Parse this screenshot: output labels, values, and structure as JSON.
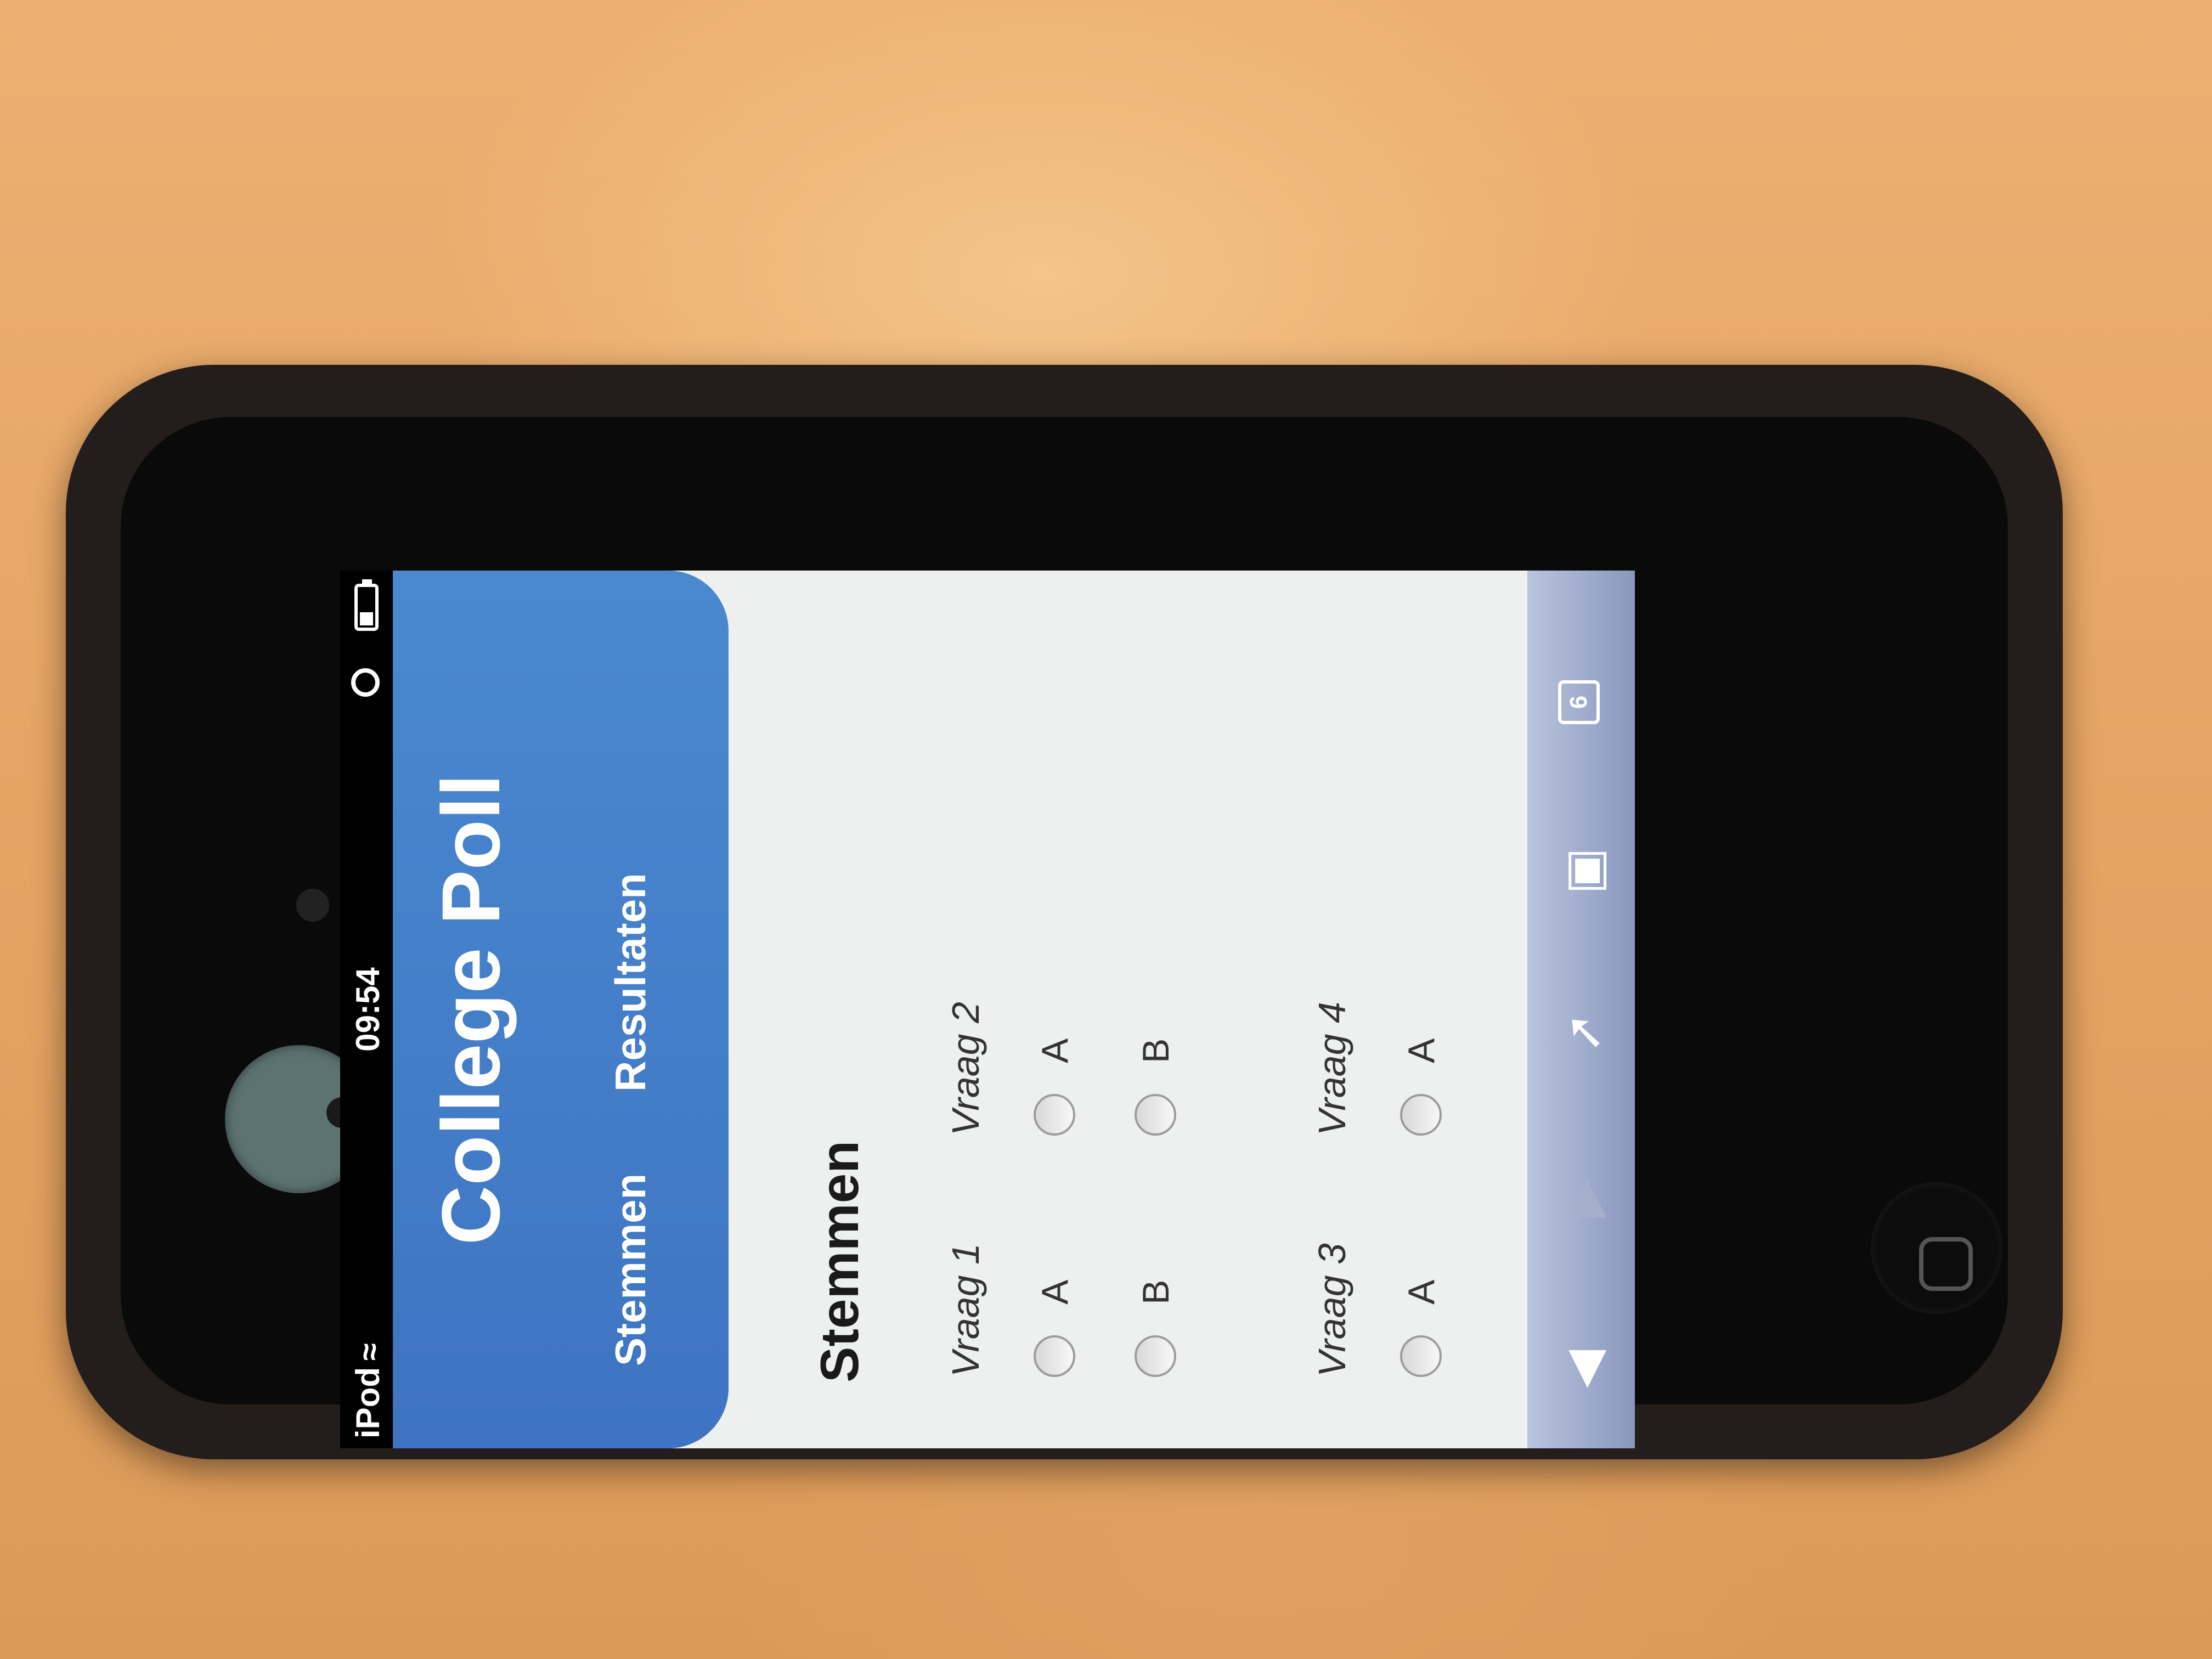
{
  "status_bar": {
    "carrier": "iPod",
    "time": "09:54"
  },
  "header": {
    "title": "College Poll",
    "tabs": [
      {
        "label": "Stemmen"
      },
      {
        "label": "Resultaten"
      }
    ]
  },
  "section_title": "Stemmen",
  "questions": [
    {
      "label": "Vraag 1",
      "options": [
        "A",
        "B"
      ]
    },
    {
      "label": "Vraag 2",
      "options": [
        "A",
        "B"
      ]
    },
    {
      "label": "Vraag 3",
      "options": [
        "A"
      ]
    },
    {
      "label": "Vraag 4",
      "options": [
        "A"
      ]
    }
  ],
  "toolbar": {
    "icons": [
      "back-icon",
      "forward-icon",
      "share-icon",
      "bookmarks-icon",
      "tabs-icon"
    ],
    "tabs_count": "6"
  },
  "colors": {
    "header": "#4a89cf",
    "toolbar": "#a0acce",
    "background": "#eef0f0"
  }
}
